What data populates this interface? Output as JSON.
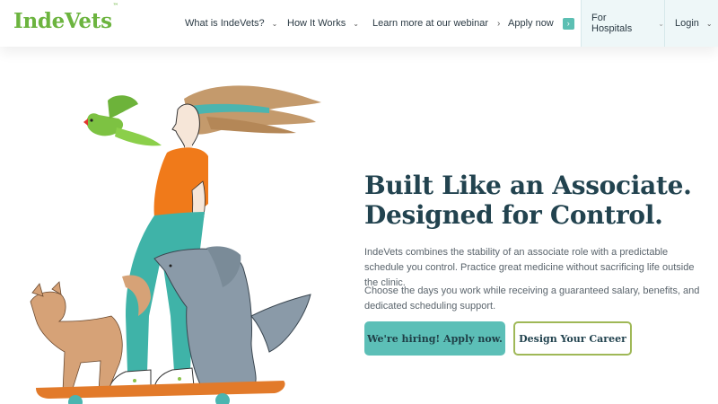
{
  "brand": {
    "logo_text": "IndeVets",
    "trademark": "™"
  },
  "nav": {
    "items": [
      {
        "label": "What is IndeVets?",
        "icon": "chevron-down-icon"
      },
      {
        "label": "How It Works",
        "icon": "chevron-down-icon"
      },
      {
        "label": "Learn more at our webinar",
        "icon": "chevron-right-icon"
      },
      {
        "label": "Apply now",
        "icon": "arrow-right-badge-icon"
      }
    ],
    "hospitals_label": "For Hospitals",
    "login_label": "Login"
  },
  "hero": {
    "headline_line1": "Built Like an Associate.",
    "headline_line2": "Designed for Control.",
    "paragraph1": "IndeVets combines the stability of an associate role with a predictable schedule you control. Practice great medicine without sacrificing life outside the clinic.",
    "paragraph2": "Choose the days you work while receiving a guaranteed salary, benefits, and dedicated scheduling support.",
    "primary_button": "We're hiring! Apply now.",
    "secondary_button": "Design Your Career"
  },
  "colors": {
    "brand_green": "#6cb43f",
    "teal": "#5cbfb7",
    "navy": "#22434f",
    "outline_green": "#9fb857"
  }
}
